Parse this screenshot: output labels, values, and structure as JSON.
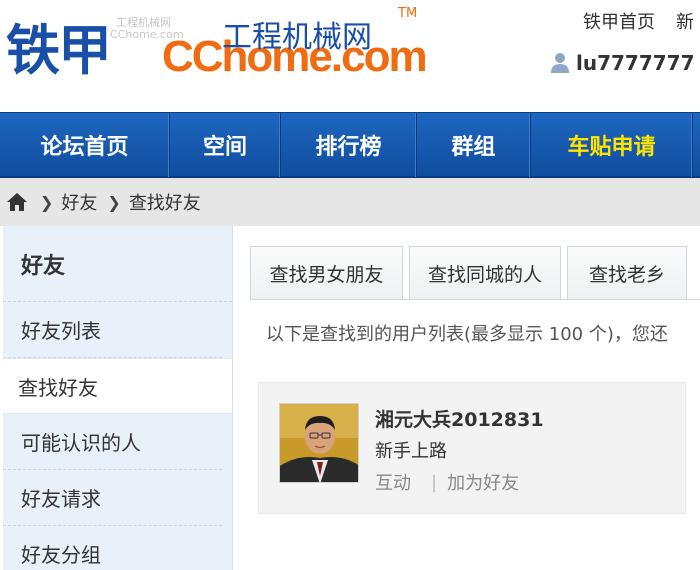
{
  "header": {
    "logo_cn": "铁甲",
    "logo_en": "CChome.com",
    "logo_tagline": "工程机械网",
    "logo_tm": "TM",
    "top_links": [
      "铁甲首页",
      "新"
    ],
    "username": "lu7777777"
  },
  "nav": {
    "items": [
      {
        "label": "论坛首页"
      },
      {
        "label": "空间"
      },
      {
        "label": "排行榜"
      },
      {
        "label": "群组"
      },
      {
        "label": "车贴申请",
        "highlight": true
      }
    ]
  },
  "breadcrumb": {
    "items": [
      "好友",
      "查找好友"
    ]
  },
  "sidebar": {
    "title": "好友",
    "items": [
      {
        "label": "好友列表"
      },
      {
        "label": "查找好友",
        "active": true
      },
      {
        "label": "可能认识的人"
      },
      {
        "label": "好友请求"
      },
      {
        "label": "好友分组"
      }
    ]
  },
  "main": {
    "tabs": [
      "查找男女朋友",
      "查找同城的人",
      "查找老乡"
    ],
    "result_text": "以下是查找到的用户列表(最多显示 100 个)，您还",
    "result": {
      "name": "湘元大兵2012831",
      "level": "新手上路",
      "action_interact": "互动",
      "action_add": "加为好友"
    }
  },
  "colors": {
    "brand_blue": "#1a4fa8",
    "brand_orange": "#ef6c12",
    "nav_bg": "#1559b0",
    "nav_highlight": "#ffe400",
    "sidebar_bg": "#e8f1f9"
  }
}
